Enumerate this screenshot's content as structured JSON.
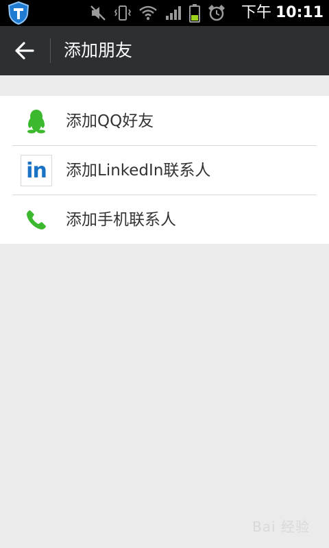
{
  "status_bar": {
    "ampm": "下午",
    "time": "10:11",
    "icons": [
      "shield-app-icon",
      "mute-icon",
      "vibrate-icon",
      "wifi-icon",
      "signal-icon",
      "battery-icon",
      "alarm-icon"
    ]
  },
  "action_bar": {
    "title": "添加朋友",
    "back_icon": "arrow-left-icon"
  },
  "list": {
    "items": [
      {
        "label": "添加QQ好友",
        "icon": "qq-penguin-icon"
      },
      {
        "label": "添加LinkedIn联系人",
        "icon": "linkedin-icon",
        "icon_text": "in"
      },
      {
        "label": "添加手机联系人",
        "icon": "phone-icon"
      }
    ]
  },
  "watermark": "Bai 经验",
  "colors": {
    "action_bar": "#2d3032",
    "background": "#ebebeb",
    "accent_green": "#3cb82e",
    "linkedin_blue": "#1a73c5"
  }
}
